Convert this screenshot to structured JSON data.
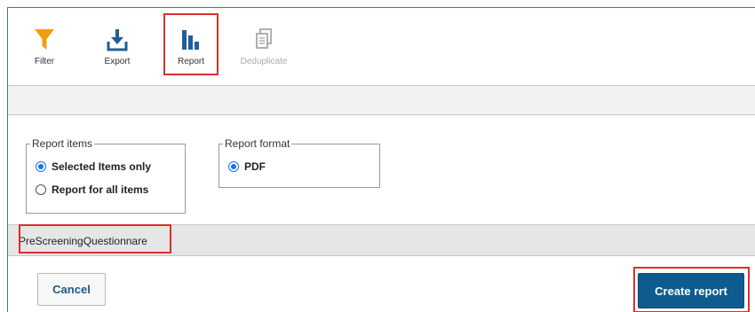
{
  "toolbar": {
    "items": [
      {
        "label": "Filter",
        "icon": "filter-icon",
        "color": "#f39c12"
      },
      {
        "label": "Export",
        "icon": "export-icon",
        "color": "#1f5f9a"
      },
      {
        "label": "Report",
        "icon": "report-chart-icon",
        "color": "#1f5f9a"
      },
      {
        "label": "Deduplicate",
        "icon": "deduplicate-icon",
        "color": "#b0b0b0",
        "disabled": true
      }
    ]
  },
  "report_items": {
    "legend": "Report items",
    "options": [
      {
        "label": "Selected Items only",
        "checked": true
      },
      {
        "label": "Report for all items",
        "checked": false
      }
    ]
  },
  "report_format": {
    "legend": "Report format",
    "options": [
      {
        "label": "PDF",
        "checked": true
      }
    ]
  },
  "tabs": [
    {
      "label": "PreScreeningQuestionnare"
    }
  ],
  "footer": {
    "cancel_label": "Cancel",
    "create_label": "Create report"
  },
  "colors": {
    "highlight": "#d9302c",
    "primary_button": "#0e5b8f",
    "radio_accent": "#1a73e8"
  }
}
